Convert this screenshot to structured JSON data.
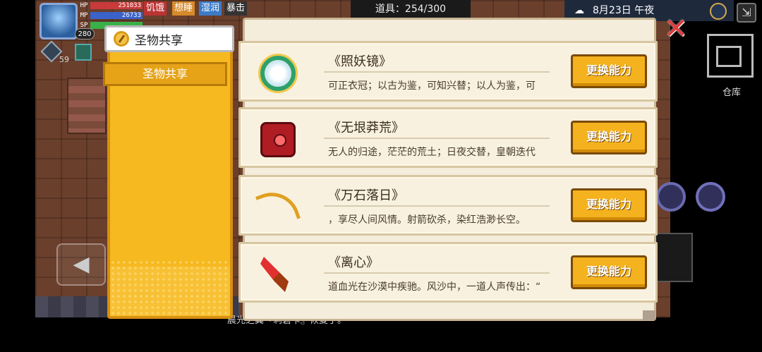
{
  "hud": {
    "hp_label": "HP",
    "hp_value": "251033",
    "mp_label": "MP",
    "mp_value": "26733",
    "sp_label": "SP",
    "level": "280",
    "statuses": [
      "饥饿",
      "想睡",
      "湿润",
      "暴击"
    ],
    "gem_count": "59"
  },
  "top_bar": {
    "items": "道具：254/300",
    "date": "8月23日 午夜",
    "warehouse_label": "仓库"
  },
  "tabs": {
    "active_label": "圣物共享",
    "sub_label": "圣物共享"
  },
  "relics": [
    {
      "name": "《照妖镜》",
      "desc": "可正衣冠；以古为鉴，可知兴替；以人为鉴，可",
      "button": "更换能力",
      "icon": "mirror-icon"
    },
    {
      "name": "《无垠莽荒》",
      "desc": "无人的归途，茫茫的荒土；日夜交替，皇朝迭代",
      "button": "更换能力",
      "icon": "belt-icon"
    },
    {
      "name": "《万石落日》",
      "desc": "，享尽人间风情。射箭砍杀，染红浩渺长空。",
      "button": "更换能力",
      "icon": "bow-icon"
    },
    {
      "name": "《离心》",
      "desc": "道血光在沙漠中疾驰。风沙中，一道人声传出：“",
      "button": "更换能力",
      "icon": "blade-icon"
    }
  ],
  "log": {
    "line1": "",
    "line2": "晨光之翼『莉碧卡』恢复了。"
  },
  "colors": {
    "accent": "#f6b91f",
    "button": "#f4b21e",
    "close": "#e23b3b"
  }
}
